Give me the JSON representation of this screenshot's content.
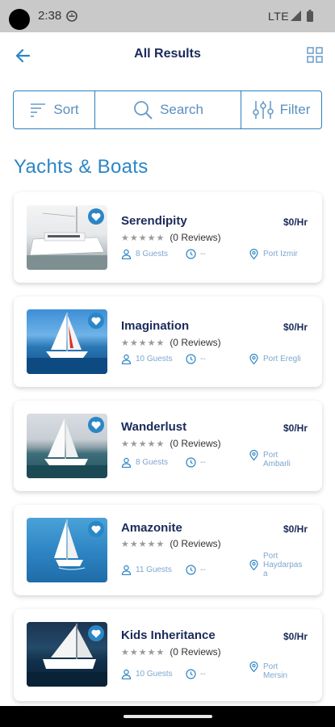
{
  "status_bar": {
    "time": "2:38",
    "network": "LTE"
  },
  "header": {
    "title": "All Results"
  },
  "toolbar": {
    "sort_label": "Sort",
    "search_label": "Search",
    "filter_label": "Filter"
  },
  "section": {
    "title": "Yachts & Boats"
  },
  "colors": {
    "accent": "#2b86c6",
    "navy": "#1a2a5a",
    "meta": "#7ea6cf"
  },
  "listings": [
    {
      "name": "Serendipity",
      "price": "$0/Hr",
      "reviews": "(0 Reviews)",
      "guests": "8 Guests",
      "duration": "--",
      "location": "Port Izmir"
    },
    {
      "name": "Imagination",
      "price": "$0/Hr",
      "reviews": "(0 Reviews)",
      "guests": "10 Guests",
      "duration": "--",
      "location": "Port Eregli"
    },
    {
      "name": "Wanderlust",
      "price": "$0/Hr",
      "reviews": "(0 Reviews)",
      "guests": "8 Guests",
      "duration": "--",
      "location": "Port\nAmbarli"
    },
    {
      "name": "Amazonite",
      "price": "$0/Hr",
      "reviews": "(0 Reviews)",
      "guests": "11 Guests",
      "duration": "--",
      "location": "Port\nHaydarpas\na"
    },
    {
      "name": "Kids Inheritance",
      "price": "$0/Hr",
      "reviews": "(0 Reviews)",
      "guests": "10 Guests",
      "duration": "--",
      "location": "Port\nMersin"
    }
  ]
}
